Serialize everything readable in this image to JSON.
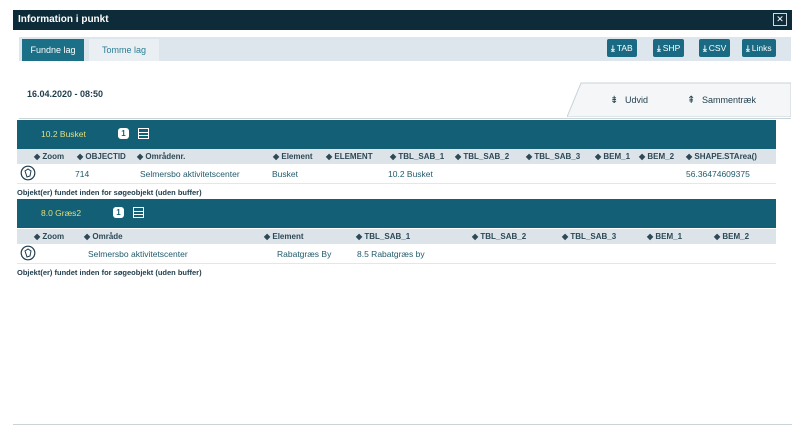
{
  "window": {
    "title": "Information i punkt",
    "close": "✕"
  },
  "tabs": [
    {
      "label": "Fundne lag",
      "active": true
    },
    {
      "label": "Tomme lag",
      "active": false
    }
  ],
  "export_buttons": [
    {
      "label": "TAB"
    },
    {
      "label": "SHP"
    },
    {
      "label": "CSV"
    },
    {
      "label": "Links"
    }
  ],
  "info": {
    "timestamp": "16.04.2020 - 08:50",
    "expand_label": "Udvid",
    "collapse_label": "Sammentræk"
  },
  "groups": [
    {
      "name": "10.2 Busket",
      "count": "1",
      "columns": [
        "◆ Zoom",
        "◆ OBJECTID",
        "◆ Områdenr.",
        "◆ Element",
        "◆ ELEMENT",
        "◆ TBL_SAB_1",
        "◆ TBL_SAB_2",
        "◆ TBL_SAB_3",
        "◆ BEM_1",
        "◆ BEM_2",
        "◆ SHAPE.STArea()"
      ],
      "rows": [
        [
          "",
          "714",
          "Selmersbo aktivitetscenter",
          "Busket",
          "",
          "10.2 Busket",
          "",
          "",
          "",
          "",
          "56.36474609375"
        ]
      ],
      "footnote": "Objekt(er) fundet inden for søgeobjekt (uden buffer)"
    },
    {
      "name": "8.0 Græs2",
      "count": "1",
      "columns": [
        "◆ Zoom",
        "◆ Område",
        "◆ Element",
        "◆ TBL_SAB_1",
        "◆ TBL_SAB_2",
        "◆ TBL_SAB_3",
        "◆ BEM_1",
        "◆ BEM_2"
      ],
      "rows": [
        [
          "",
          "Selmersbo aktivitetscenter",
          "Rabatgræs By",
          "8.5 Rabatgræs by",
          "",
          "",
          "",
          ""
        ]
      ],
      "footnote": "Objekt(er) fundet inden for søgeobjekt (uden buffer)"
    }
  ],
  "colors": {
    "titlebar": "#0e2b3a",
    "accent": "#135f76",
    "group_name": "#e4df7a"
  }
}
